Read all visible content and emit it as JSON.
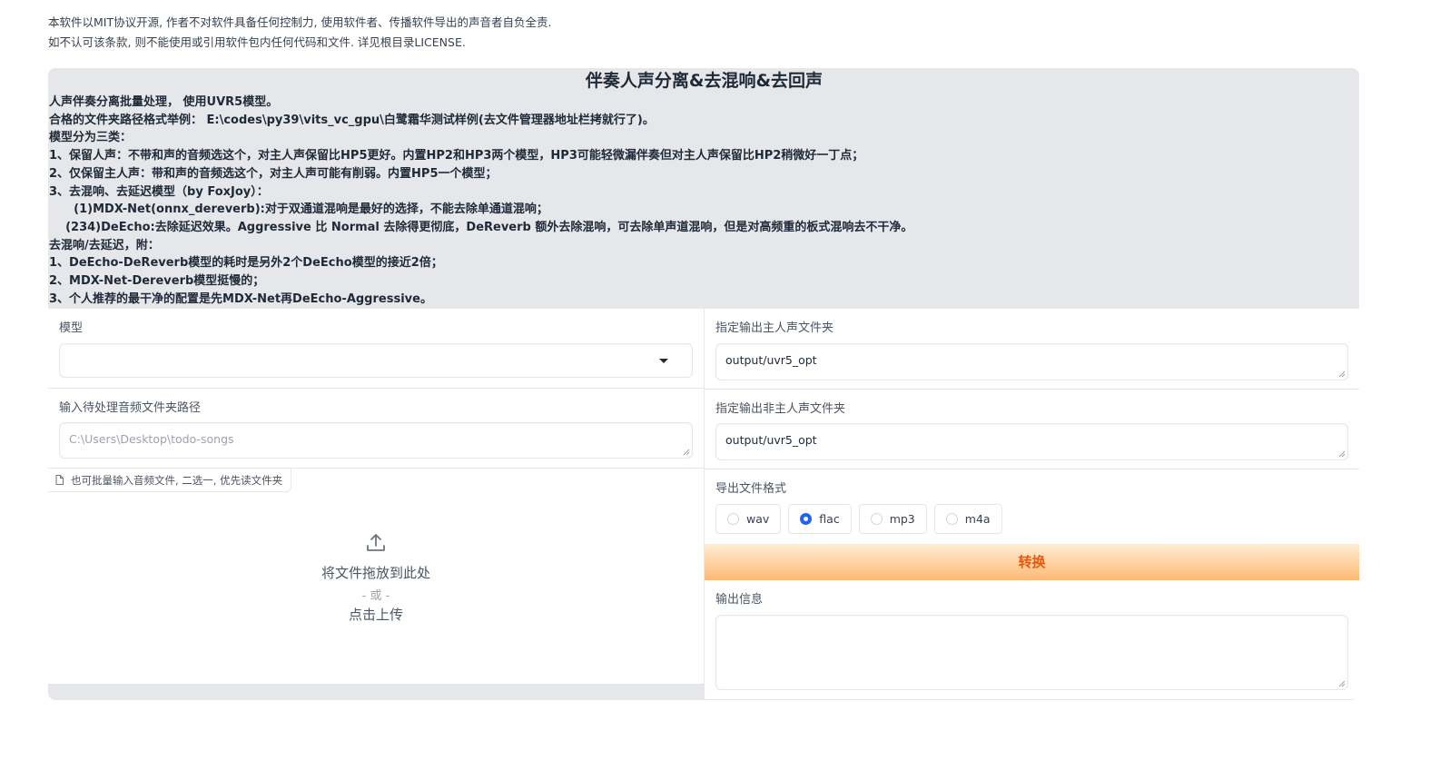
{
  "disclaimer": {
    "line1": "本软件以MIT协议开源, 作者不对软件具备任何控制力, 使用软件者、传播软件导出的声音者自负全责.",
    "line2": "如不认可该条款, 则不能使用或引用软件包内任何代码和文件. 详见根目录LICENSE."
  },
  "section": {
    "title": "伴奏人声分离&去混响&去回声",
    "lines": [
      "人声伴奏分离批量处理， 使用UVR5模型。",
      "合格的文件夹路径格式举例： E:\\codes\\py39\\vits_vc_gpu\\白鹭霜华测试样例(去文件管理器地址栏拷就行了)。",
      "模型分为三类：",
      "1、保留人声：不带和声的音频选这个，对主人声保留比HP5更好。内置HP2和HP3两个模型，HP3可能轻微漏伴奏但对主人声保留比HP2稍微好一丁点；",
      "2、仅保留主人声：带和声的音频选这个，对主人声可能有削弱。内置HP5一个模型；",
      "3、去混响、去延迟模型（by FoxJoy）：",
      "      (1)MDX-Net(onnx_dereverb):对于双通道混响是最好的选择，不能去除单通道混响；",
      "    (234)DeEcho:去除延迟效果。Aggressive 比 Normal 去除得更彻底，DeReverb 额外去除混响，可去除单声道混响，但是对高频重的板式混响去不干净。",
      "去混响/去延迟，附：",
      "1、DeEcho-DeReverb模型的耗时是另外2个DeEcho模型的接近2倍；",
      "2、MDX-Net-Dereverb模型挺慢的；",
      "3、个人推荐的最干净的配置是先MDX-Net再DeEcho-Aggressive。"
    ]
  },
  "left": {
    "model_label": "模型",
    "model_value": "",
    "input_dir_label": "输入待处理音频文件夹路径",
    "input_dir_placeholder": "C:\\Users\\Desktop\\todo-songs",
    "file_label": "也可批量输入音频文件, 二选一, 优先读文件夹",
    "upload_text": "将文件拖放到此处",
    "upload_or": "- 或 -",
    "upload_click": "点击上传"
  },
  "right": {
    "vocal_out_label": "指定输出主人声文件夹",
    "vocal_out_value": "output/uvr5_opt",
    "ins_out_label": "指定输出非主人声文件夹",
    "ins_out_value": "output/uvr5_opt",
    "format_label": "导出文件格式",
    "formats": [
      "wav",
      "flac",
      "mp3",
      "m4a"
    ],
    "selected_format": "flac",
    "convert_label": "转换",
    "output_info_label": "输出信息",
    "output_info_value": ""
  },
  "colors": {
    "accent": "#2563eb",
    "button_gradient_start": "#ffedd5",
    "button_gradient_end": "#fdba74",
    "button_text": "#ea580c",
    "panel_bg": "#e5e7eb"
  }
}
